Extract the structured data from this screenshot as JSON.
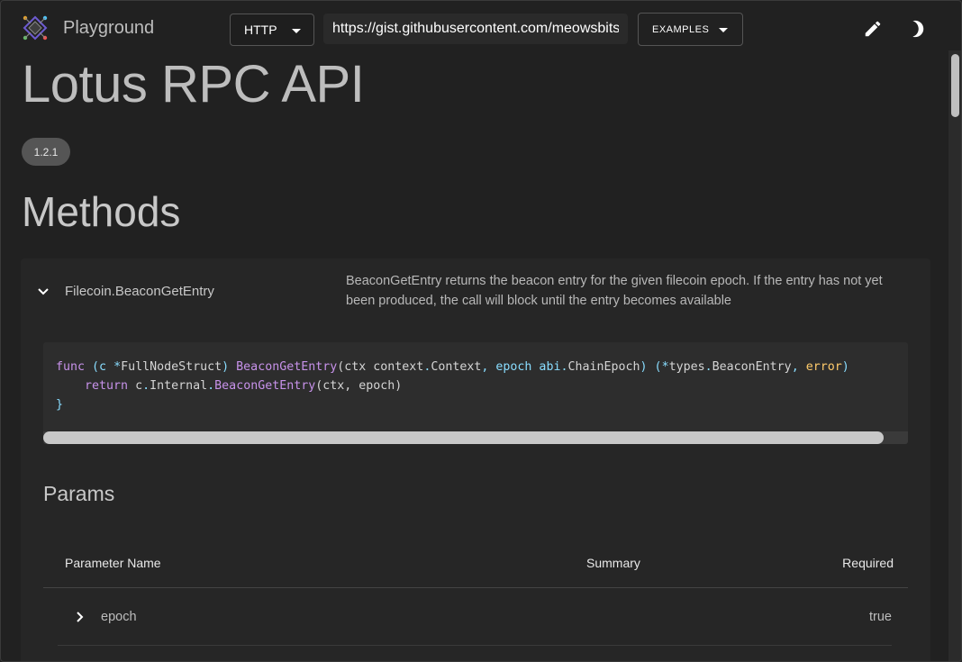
{
  "header": {
    "app_title": "Playground",
    "transport": "HTTP",
    "url": "https://gist.githubusercontent.com/meowsbits",
    "examples_label": "EXAMPLES",
    "icons": {
      "logo": "playground-logo-icon",
      "edit": "pencil-icon",
      "theme": "moon-icon"
    }
  },
  "main": {
    "title": "Lotus RPC API",
    "version": "1.2.1",
    "section_title": "Methods",
    "method": {
      "name": "Filecoin.BeaconGetEntry",
      "description": "BeaconGetEntry returns the beacon entry for the given filecoin epoch. If the entry has not yet been produced, the call will block until the entry becomes available",
      "code": {
        "line1": {
          "kw_func": "func",
          "p1": " (c ",
          "star": "*",
          "recv": "FullNodeStruct",
          "p2": ") ",
          "fname": "BeaconGetEntry",
          "p3": "(ctx context",
          "dot1": ".",
          "ctxtype": "Context",
          "p4": ", epoch abi",
          "dot2": ".",
          "epochtype": "ChainEpoch",
          "p5": ") (",
          "star2": "*",
          "rtype": "types",
          "dot3": ".",
          "rtype2": "BeaconEntry",
          "p6": ", ",
          "err": "error",
          "p7": ")"
        },
        "line2": {
          "kw_return": "return",
          "p1": " c",
          "dot1": ".",
          "internal": "Internal",
          "dot2": ".",
          "fname": "BeaconGetEntry",
          "p2": "(ctx, epoch)"
        },
        "line3": "}"
      }
    },
    "params": {
      "title": "Params",
      "columns": [
        "Parameter Name",
        "Summary",
        "Required"
      ],
      "rows": [
        {
          "name": "epoch",
          "summary": "",
          "required": "true"
        }
      ]
    }
  }
}
